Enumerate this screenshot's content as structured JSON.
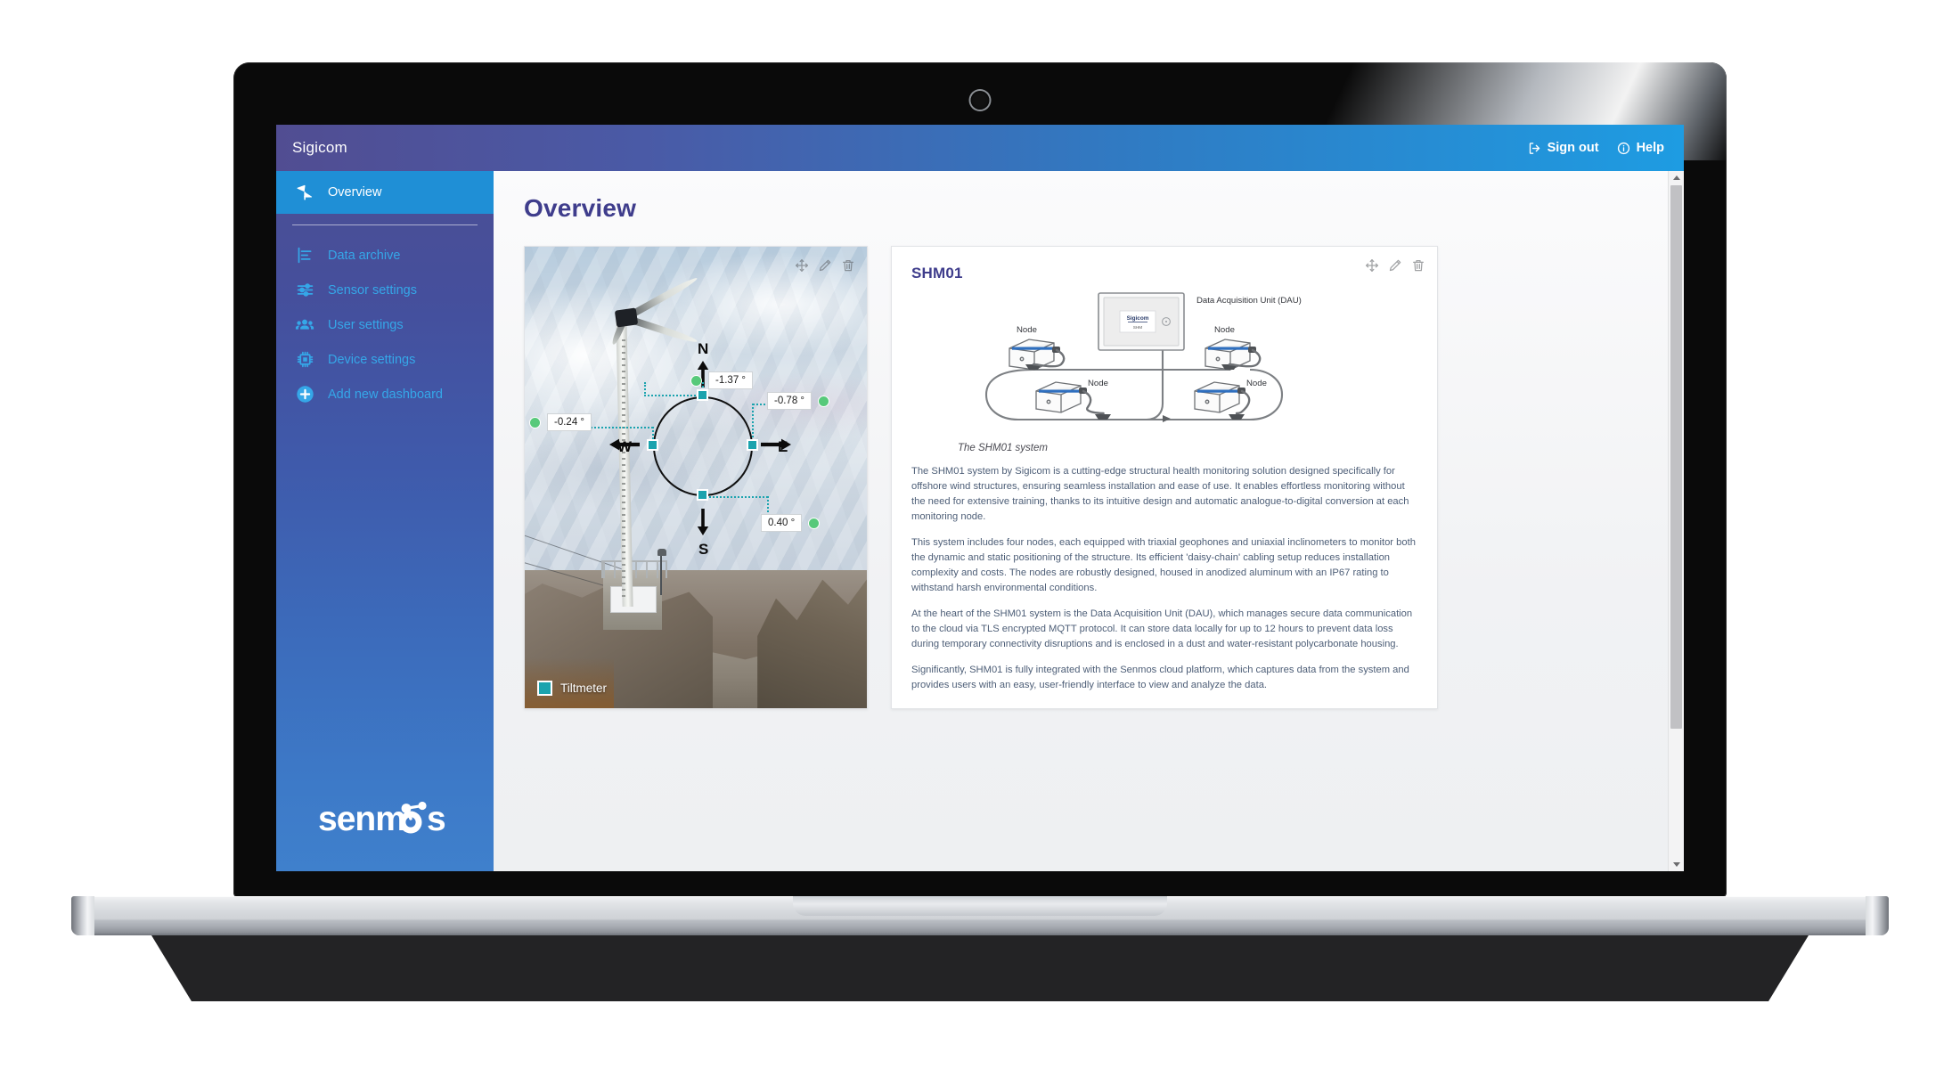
{
  "app": {
    "brand": "Sigicom",
    "topbar": {
      "sign_out_label": "Sign out",
      "help_label": "Help"
    }
  },
  "sidebar": {
    "active_item": "Overview",
    "items": [
      {
        "label": "Overview",
        "icon": "turbine-icon",
        "active": true
      },
      {
        "label": "Data archive",
        "icon": "bar-chart-icon",
        "active": false
      },
      {
        "label": "Sensor settings",
        "icon": "sliders-icon",
        "active": false
      },
      {
        "label": "User settings",
        "icon": "users-icon",
        "active": false
      },
      {
        "label": "Device settings",
        "icon": "chip-icon",
        "active": false
      },
      {
        "label": "Add new dashboard",
        "icon": "plus-circle-icon",
        "active": false
      }
    ],
    "logo_text": "senmos"
  },
  "page": {
    "title": "Overview"
  },
  "widgets": {
    "tiltmeter": {
      "tools": [
        "move-icon",
        "edit-icon",
        "delete-icon"
      ],
      "legend_label": "Tiltmeter",
      "compass": {
        "north": "N",
        "east": "E",
        "south": "S",
        "west": "W"
      },
      "readings": [
        {
          "position": "north",
          "value": "-1.37 °",
          "status": "ok"
        },
        {
          "position": "east",
          "value": "-0.78 °",
          "status": "ok"
        },
        {
          "position": "west",
          "value": "-0.24 °",
          "status": "ok"
        },
        {
          "position": "south",
          "value": "0.40 °",
          "status": "ok"
        }
      ],
      "status_color": "#57c97a",
      "node_color": "#1ba3ae"
    },
    "shm01": {
      "title": "SHM01",
      "tools": [
        "move-icon",
        "edit-icon",
        "delete-icon"
      ],
      "diagram": {
        "dau_label": "Data Acquisition Unit (DAU)",
        "node_labels": [
          "Node",
          "Node",
          "Node",
          "Node"
        ],
        "dau_screen_brand": "Sigicom",
        "caption": "The SHM01 system"
      },
      "paragraphs": [
        "The SHM01 system by Sigicom is a cutting-edge structural health monitoring solution designed specifically for offshore wind structures, ensuring seamless installation and ease of use. It enables effortless monitoring without the need for extensive training, thanks to its intuitive design and automatic analogue-to-digital conversion at each monitoring node.",
        "This system includes four nodes, each equipped with triaxial geophones and uniaxial inclinometers to monitor both the dynamic and static positioning of the structure. Its efficient 'daisy-chain' cabling setup reduces installation complexity and costs. The nodes are robustly designed, housed in anodized aluminum with an IP67 rating to withstand harsh environmental conditions.",
        "At the heart of the SHM01 system is the Data Acquisition Unit (DAU), which manages secure data communication to the cloud via TLS encrypted MQTT protocol. It can store data locally for up to 12 hours to prevent data loss during temporary connectivity disruptions and is enclosed in a dust and water-resistant polycarbonate housing.",
        "Significantly, SHM01 is fully integrated with the Senmos cloud platform, which captures data from the system and provides users with an easy, user-friendly interface to view and analyze the data."
      ]
    }
  },
  "theme": {
    "header_gradient_start": "#514d92",
    "header_gradient_end": "#1e9ce2",
    "sidebar_gradient_start": "#4b4f95",
    "sidebar_gradient_end": "#3f80cc",
    "sidebar_active": "#1f8fd6",
    "sidebar_link": "#35a7e8",
    "title_color": "#3f3d8c",
    "body_text_color": "#4d5e77"
  }
}
